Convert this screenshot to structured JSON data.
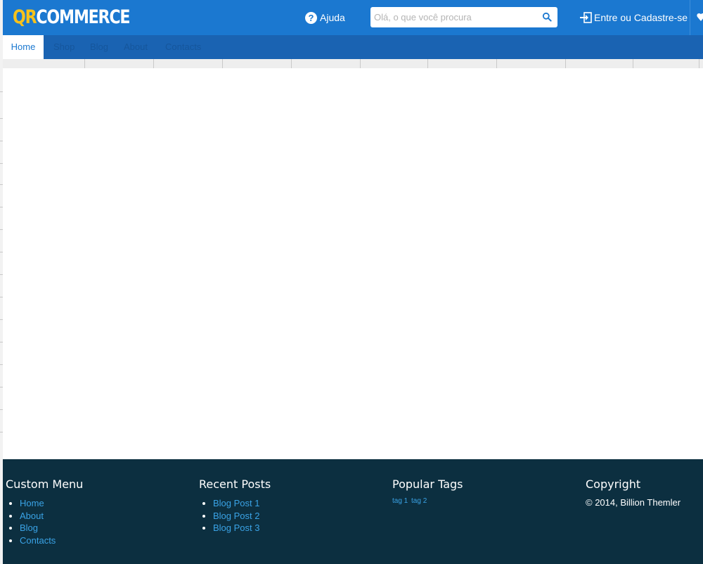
{
  "header": {
    "logo": {
      "part1": "QR",
      "part2": "COMMERCE"
    },
    "help_label": "Ajuda",
    "search": {
      "placeholder": "Olá, o que você procura",
      "value": ""
    },
    "login_label": "Entre ou Cadastre-se"
  },
  "nav": {
    "items": [
      {
        "label": "Home",
        "active": true
      },
      {
        "label": "Shop"
      },
      {
        "label": "Blog"
      },
      {
        "label": "About"
      },
      {
        "label": "Contacts"
      }
    ]
  },
  "footer": {
    "custom_menu": {
      "title": "Custom Menu",
      "items": [
        "Home",
        "About",
        "Blog",
        "Contacts"
      ]
    },
    "recent_posts": {
      "title": "Recent Posts",
      "items": [
        "Blog Post 1",
        "Blog Post 2",
        "Blog Post 3"
      ]
    },
    "popular_tags": {
      "title": "Popular Tags",
      "tags": [
        "tag 1",
        "tag 2"
      ]
    },
    "copyright": {
      "title": "Copyright",
      "text": "© 2014, Billion Themler"
    }
  },
  "colors": {
    "topbar": "#1b78d0",
    "navbar": "#1a63b2",
    "footer": "#0c2f40",
    "logo_accent": "#f7c21b",
    "link": "#3aa3e6"
  },
  "icons": {
    "help": "question-circle-icon",
    "search": "search-icon",
    "login": "sign-in-icon"
  }
}
